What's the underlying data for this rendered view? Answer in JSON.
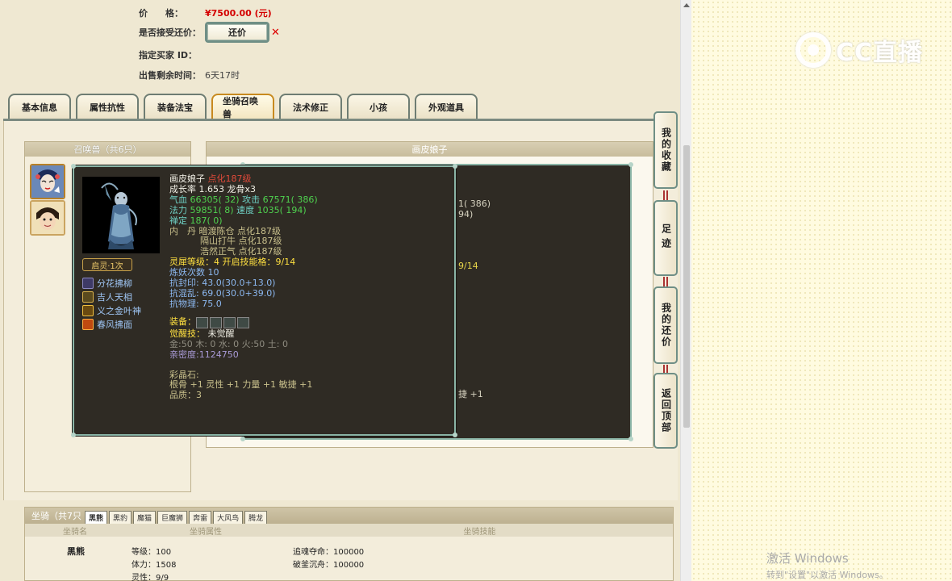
{
  "info": {
    "price_label": "价　　格：",
    "price_value": "¥7500.00 (元)",
    "counter_label": "是否接受还价：",
    "counter_btn": "还价",
    "counter_x": "✕",
    "buyer_label": "指定买家 ID：",
    "time_label": "出售剩余时间：",
    "time_value": "6天17时"
  },
  "tabs": [
    "基本信息",
    "属性抗性",
    "装备法宝",
    "坐骑召唤兽",
    "法术修正",
    "小孩",
    "外观道具"
  ],
  "pets_panel": {
    "title": "召唤兽（共6只）"
  },
  "detail_panel": {
    "title": "画皮娘子"
  },
  "side_buttons": [
    "我的收藏",
    "足迹",
    "我的还价",
    "返回顶部"
  ],
  "tooltip": {
    "awake": "启灵·1次",
    "skills": [
      "分花拂柳",
      "吉人天相",
      "义之金叶神",
      "春风拂面"
    ],
    "name": "画皮娘子",
    "name_tag": "点化187级",
    "growth": "成长率 1.653 龙骨x3",
    "hp_label": "气血",
    "hp_value": "66305( 32)",
    "atk_label": "攻击",
    "atk_value": "67571( 386)",
    "mp_label": "法力",
    "mp_value": "59851( 8)",
    "spd_label": "速度",
    "spd_value": "1035( 194)",
    "zen_label": "禅定",
    "zen_value": "187( 0)",
    "core_label": "内　丹",
    "core_1": "暗渡陈仓 点化187级",
    "core_2": "隔山打牛 点化187级",
    "core_3": "浩然正气 点化187级",
    "spirit": "灵犀等级：4 开启技能格：9/14",
    "refine": "炼妖次数 10",
    "res_seal": "抗封印: 43.0(30.0+13.0)",
    "res_chaos": "抗混乱: 69.0(30.0+39.0)",
    "res_phys": "抗物理: 75.0",
    "equip_label": "装备：",
    "awaken_label": "觉醒技：",
    "awaken_value": "未觉醒",
    "elements": "金:50 木: 0 水: 0 火:50 土: 0",
    "intimacy": "亲密度:1124750",
    "gem_title": "彩晶石:",
    "gem_line": "根骨 +1 灵性 +1 力量 +1 敏捷 +1",
    "quality": "品质：3"
  },
  "back_frags": {
    "f1": "1( 386)",
    "f2": "94)",
    "f3": "9/14",
    "f4": "捷 +1"
  },
  "mounts": {
    "title": "坐骑（共7只",
    "tabs": [
      "黑熊",
      "黑豹",
      "魔猫",
      "巨魔狮",
      "奔雷",
      "大风鸟",
      "腾龙"
    ],
    "cols": [
      "坐骑名",
      "坐骑属性",
      "坐骑技能"
    ],
    "name": "黑熊",
    "level": "等级：100",
    "stamina": "体力：1508",
    "spirit": "灵性：9/9",
    "skill_1": "追魂夺命：100000",
    "skill_2": "破釜沉舟：100000"
  },
  "overlay": {
    "logo": "CC直播",
    "activate_1": "激活 Windows",
    "activate_2": "转到\"设置\"以激活 Windows。"
  }
}
